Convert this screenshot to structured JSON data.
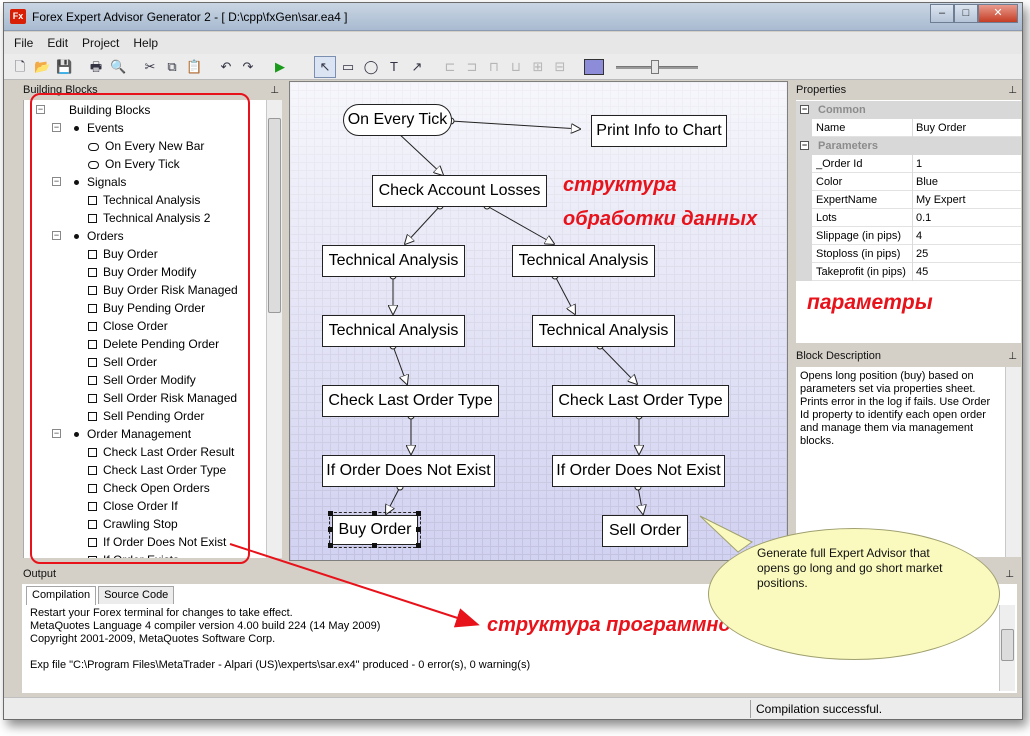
{
  "window": {
    "app_icon": "Fx",
    "title": "Forex Expert Advisor Generator 2 - [ D:\\cpp\\fxGen\\sar.ea4 ]",
    "minimize_glyph": "–",
    "maximize_glyph": "□",
    "close_glyph": "✕"
  },
  "menu": [
    "File",
    "Edit",
    "Project",
    "Help"
  ],
  "toolbar_icons": [
    "new-icon",
    "open-icon",
    "save-icon",
    "print-icon",
    "print-preview-icon",
    "cut-icon",
    "copy-icon",
    "paste-icon",
    "undo-icon",
    "redo-icon",
    "run-icon",
    "pointer-tool-icon",
    "rectangle-tool-icon",
    "ellipse-tool-icon",
    "text-tool-icon",
    "arrow-tool-icon",
    "align-left-icon",
    "align-center-icon",
    "align-top-icon",
    "align-bottom-icon",
    "distribute-icon",
    "size-icon",
    "color-icon"
  ],
  "pin_glyph": "⊥",
  "building_blocks": {
    "title": "Building Blocks",
    "root": "Building Blocks",
    "groups": [
      {
        "label": "Events",
        "items": [
          "On Every New Bar",
          "On Every Tick"
        ]
      },
      {
        "label": "Signals",
        "items": [
          "Technical Analysis",
          "Technical Analysis 2"
        ]
      },
      {
        "label": "Orders",
        "items": [
          "Buy Order",
          "Buy Order Modify",
          "Buy Order Risk Managed",
          "Buy Pending Order",
          "Close Order",
          "Delete Pending Order",
          "Sell Order",
          "Sell Order Modify",
          "Sell Order Risk Managed",
          "Sell Pending Order"
        ]
      },
      {
        "label": "Order Management",
        "items": [
          "Check Last Order Result",
          "Check Last Order Type",
          "Check Open Orders",
          "Close Order If",
          "Crawling Stop",
          "If Order Does Not Exist",
          "If Order Exists"
        ]
      }
    ]
  },
  "canvas": {
    "blocks": {
      "on_every_tick": "On Every Tick",
      "print_info": "Print Info to Chart",
      "check_account_losses": "Check Account Losses",
      "ta_left_1": "Technical Analysis",
      "ta_right_1": "Technical Analysis",
      "ta_left_2": "Technical Analysis",
      "ta_right_2": "Technical Analysis",
      "clot_left": "Check Last Order Type",
      "clot_right": "Check Last Order Type",
      "if_not_exist_left": "If Order Does Not Exist",
      "if_not_exist_right": "If Order Does Not Exist",
      "buy_order": "Buy Order",
      "sell_order": "Sell Order"
    }
  },
  "properties": {
    "title": "Properties",
    "categories": [
      {
        "label": "Common",
        "rows": [
          {
            "key": "Name",
            "value": "Buy Order"
          }
        ]
      },
      {
        "label": "Parameters",
        "rows": [
          {
            "key": "_Order Id",
            "value": "1"
          },
          {
            "key": "Color",
            "value": "Blue"
          },
          {
            "key": "ExpertName",
            "value": "My Expert"
          },
          {
            "key": "Lots",
            "value": "0.1"
          },
          {
            "key": "Slippage (in pips)",
            "value": "4"
          },
          {
            "key": "Stoploss (in pips)",
            "value": "25"
          },
          {
            "key": "Takeprofit (in pips)",
            "value": "45"
          }
        ]
      }
    ],
    "expand_glyph": "−"
  },
  "block_description": {
    "title": "Block Description",
    "text": "Opens long position (buy) based on parameters set via properties sheet. Prints error in the log if fails. Use Order Id property to identify each open order and manage them via management blocks."
  },
  "output": {
    "title": "Output",
    "tabs": [
      "Compilation",
      "Source Code"
    ],
    "lines": [
      "Restart your Forex terminal for changes to take effect.",
      "MetaQuotes Language 4 compiler version 4.00 build 224 (14 May 2009)",
      "Copyright 2001-2009, MetaQuotes Software Corp.",
      "",
      "Exp file \"C:\\Program Files\\MetaTrader - Alpari (US)\\experts\\sar.ex4\" produced - 0 error(s), 0 warning(s)"
    ]
  },
  "status": {
    "text": "Compilation successful."
  },
  "annotations": {
    "structure_line1": "структура",
    "structure_line2": "обработки данных",
    "params": "параметры",
    "code_structure": "структура программного кода",
    "bubble": "Generate full Expert Advisor that opens go long and go short market positions."
  },
  "colors": {
    "annotation_red": "#e8121b",
    "canvas_tint": "#dcdcf2",
    "bubble_fill": "#fafabf",
    "close_red": "#c53d25"
  }
}
